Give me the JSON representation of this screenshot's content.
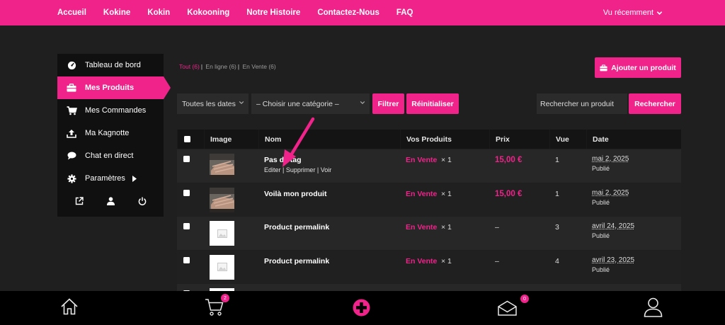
{
  "topnav": {
    "items": [
      "Accueil",
      "Kokine",
      "Kokin",
      "Kokooning",
      "Notre Histoire",
      "Contactez-Nous",
      "FAQ"
    ],
    "recent": "Vu récemment"
  },
  "sidebar": {
    "items": [
      {
        "label": "Tableau de bord",
        "icon": "dashboard-icon"
      },
      {
        "label": "Mes Produits",
        "icon": "briefcase-icon",
        "active": true
      },
      {
        "label": "Mes Commandes",
        "icon": "cart-icon"
      },
      {
        "label": "Ma Kagnotte",
        "icon": "upload-icon"
      },
      {
        "label": "Chat en direct",
        "icon": "chat-icon"
      },
      {
        "label": "Paramètres",
        "icon": "gear-icon"
      }
    ]
  },
  "filters": {
    "all": "Tout (6)",
    "online": "En ligne (6)",
    "on_sale": "En Vente (6)"
  },
  "add_button": "Ajouter un produit",
  "toolbar": {
    "dates": "Toutes les dates",
    "category": "– Choisir une catégorie –",
    "filter": "Filtrer",
    "reset": "Réinitialiser",
    "search_placeholder": "Rechercher un produit",
    "search": "Rechercher"
  },
  "table": {
    "headers": [
      "Image",
      "Nom",
      "Vos Produits",
      "Prix",
      "Vue",
      "Date"
    ],
    "rows": [
      {
        "name": "Pas de tag",
        "actions": "Editer | Supprimer | Voir",
        "status": "En Vente",
        "qty": "× 1",
        "price": "15,00 €",
        "views": "1",
        "date": "mai 2, 2025",
        "published": "Publié",
        "image": "photo"
      },
      {
        "name": "Voilà mon produit",
        "actions": "",
        "status": "En Vente",
        "qty": "× 1",
        "price": "15,00 €",
        "views": "1",
        "date": "mai 2, 2025",
        "published": "Publié",
        "image": "photo"
      },
      {
        "name": "Product permalink",
        "actions": "",
        "status": "En Vente",
        "qty": "× 1",
        "price": "–",
        "views": "3",
        "date": "avril 24, 2025",
        "published": "Publié",
        "image": "placeholder"
      },
      {
        "name": "Product permalink",
        "actions": "",
        "status": "En Vente",
        "qty": "× 1",
        "price": "–",
        "views": "4",
        "date": "avril 23, 2025",
        "published": "Publié",
        "image": "placeholder"
      }
    ]
  },
  "bottombar": {
    "cart_count": "2",
    "mail_count": "0"
  },
  "colors": {
    "accent": "#f0238b",
    "background": "#1f1f1f",
    "sidebar": "#101010",
    "bottombar": "#000000"
  }
}
